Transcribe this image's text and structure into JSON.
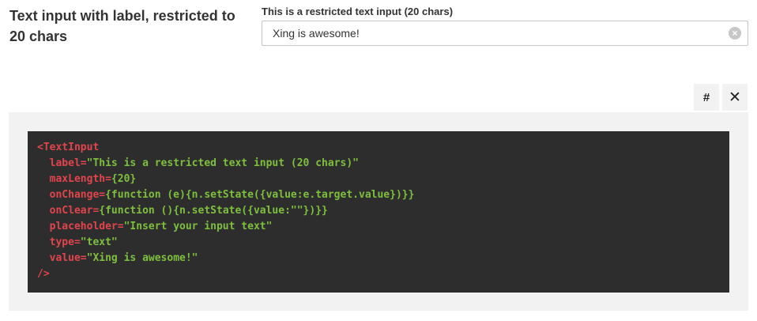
{
  "example": {
    "title": "Text input with label, restricted to 20 chars"
  },
  "field": {
    "label": "This is a restricted text input (20 chars)",
    "value": "Xing is awesome!",
    "placeholder": "Insert your input text",
    "clear_icon": "clear-circle-icon"
  },
  "toolbar": {
    "hash_label": "#",
    "close_label": "✕"
  },
  "code": {
    "open_tag": "<TextInput",
    "label_attr": "  label=",
    "label_val": "\"This is a restricted text input (20 chars)\"",
    "maxlength_attr": "  maxLength=",
    "maxlength_val": "{20}",
    "onchange_attr": "  onChange=",
    "onchange_val": "{function (e){n.setState({value:e.target.value})}}",
    "onclear_attr": "  onClear=",
    "onclear_val": "{function (){n.setState({value:\"\"})}}",
    "placeholder_attr": "  placeholder=",
    "placeholder_val": "\"Insert your input text\"",
    "type_attr": "  type=",
    "type_val": "\"text\"",
    "value_attr": "  value=",
    "value_val": "\"Xing is awesome!\"",
    "close_tag": "/>"
  },
  "colors": {
    "code_bg": "#2d2d2d",
    "code_tag": "#e0454e",
    "code_string": "#7fbf3f",
    "panel_bg": "#f2f2f2"
  }
}
